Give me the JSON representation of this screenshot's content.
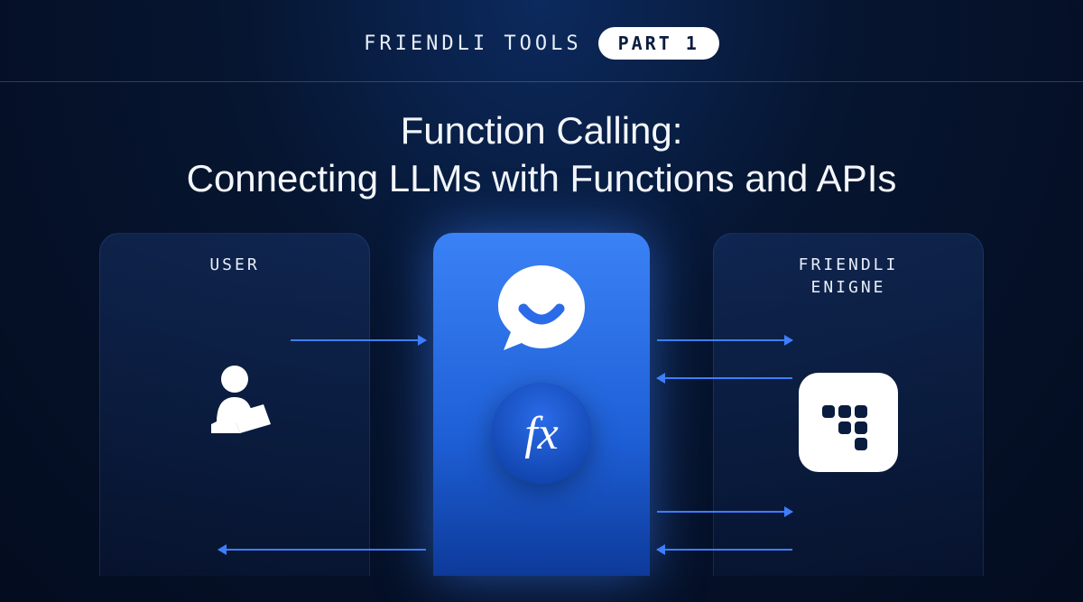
{
  "header": {
    "label": "FRIENDLI TOOLS",
    "badge": "PART 1"
  },
  "title_line1": "Function Calling:",
  "title_line2": "Connecting LLMs with Functions and APIs",
  "panels": {
    "left_label": "USER",
    "right_label": "FRIENDLI\nENIGNE",
    "fx_label": "fx"
  },
  "icons": {
    "user": "user-laptop-icon",
    "chat": "chat-bubble-smile-icon",
    "fx": "fx-function-icon",
    "engine": "friendli-engine-icon"
  }
}
